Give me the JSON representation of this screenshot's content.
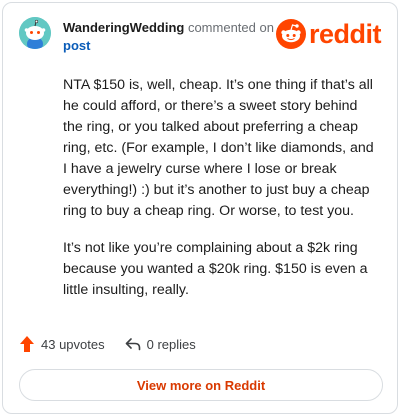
{
  "header": {
    "username": "WanderingWedding",
    "action_text": "commented on",
    "post_link": "post",
    "logo_text": "reddit",
    "avatar_icon": "snoo-avatar-icon",
    "logo_icon": "reddit-snoo-icon"
  },
  "comment": {
    "paragraphs": [
      "NTA $150 is, well, cheap. It’s one thing if that’s all he could afford, or there’s a sweet story behind the ring, or you talked about preferring a cheap ring, etc. (For example, I don’t like diamonds, and I have a jewelry curse where I lose or break everything!) :) but it’s another to just buy a cheap ring to buy a cheap ring. Or worse, to test you.",
      "It’s not like you’re complaining about a $2k ring because you wanted a $20k ring. $150 is even a little insulting, really."
    ]
  },
  "actions": {
    "upvotes": "43 upvotes",
    "replies": "0 replies",
    "upvote_icon": "upvote-arrow-icon",
    "reply_icon": "reply-arrow-icon"
  },
  "footer": {
    "view_more": "View more on Reddit"
  },
  "colors": {
    "brand": "#ff4500",
    "link": "#0a5cb8",
    "cta": "#d93900",
    "avatar_bg": "#62c8c3"
  }
}
